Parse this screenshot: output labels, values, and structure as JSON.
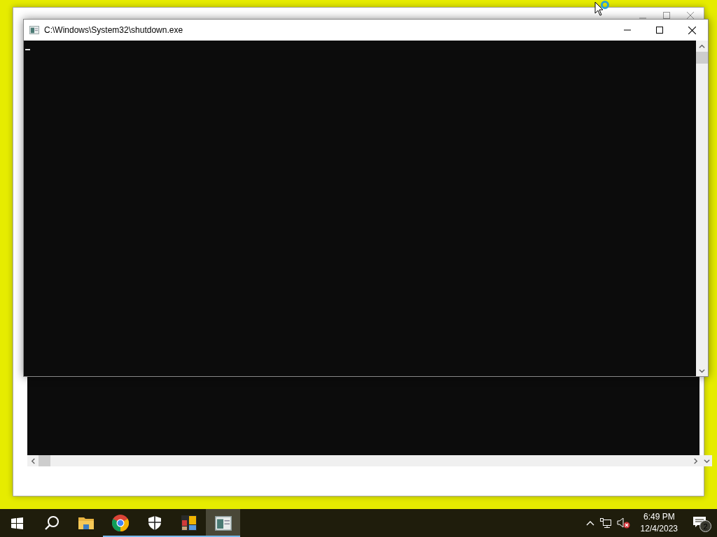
{
  "background_window": {
    "kind": "console"
  },
  "console_window": {
    "title": "C:\\Windows\\System32\\shutdown.exe",
    "cursor_visible": true
  },
  "taskbar": {
    "apps": [
      {
        "kind": "start",
        "running": false,
        "selected": false
      },
      {
        "kind": "search",
        "running": false,
        "selected": false
      },
      {
        "kind": "folder",
        "running": false,
        "selected": false
      },
      {
        "kind": "chrome",
        "running": true,
        "selected": false
      },
      {
        "kind": "shield",
        "running": true,
        "selected": false
      },
      {
        "kind": "tiles",
        "running": true,
        "selected": false
      },
      {
        "kind": "console",
        "running": true,
        "selected": true
      }
    ],
    "tray": {
      "muted": true
    },
    "clock": {
      "time": "6:49 PM",
      "date": "12/4/2023"
    },
    "notifications": {
      "count": "2"
    }
  }
}
